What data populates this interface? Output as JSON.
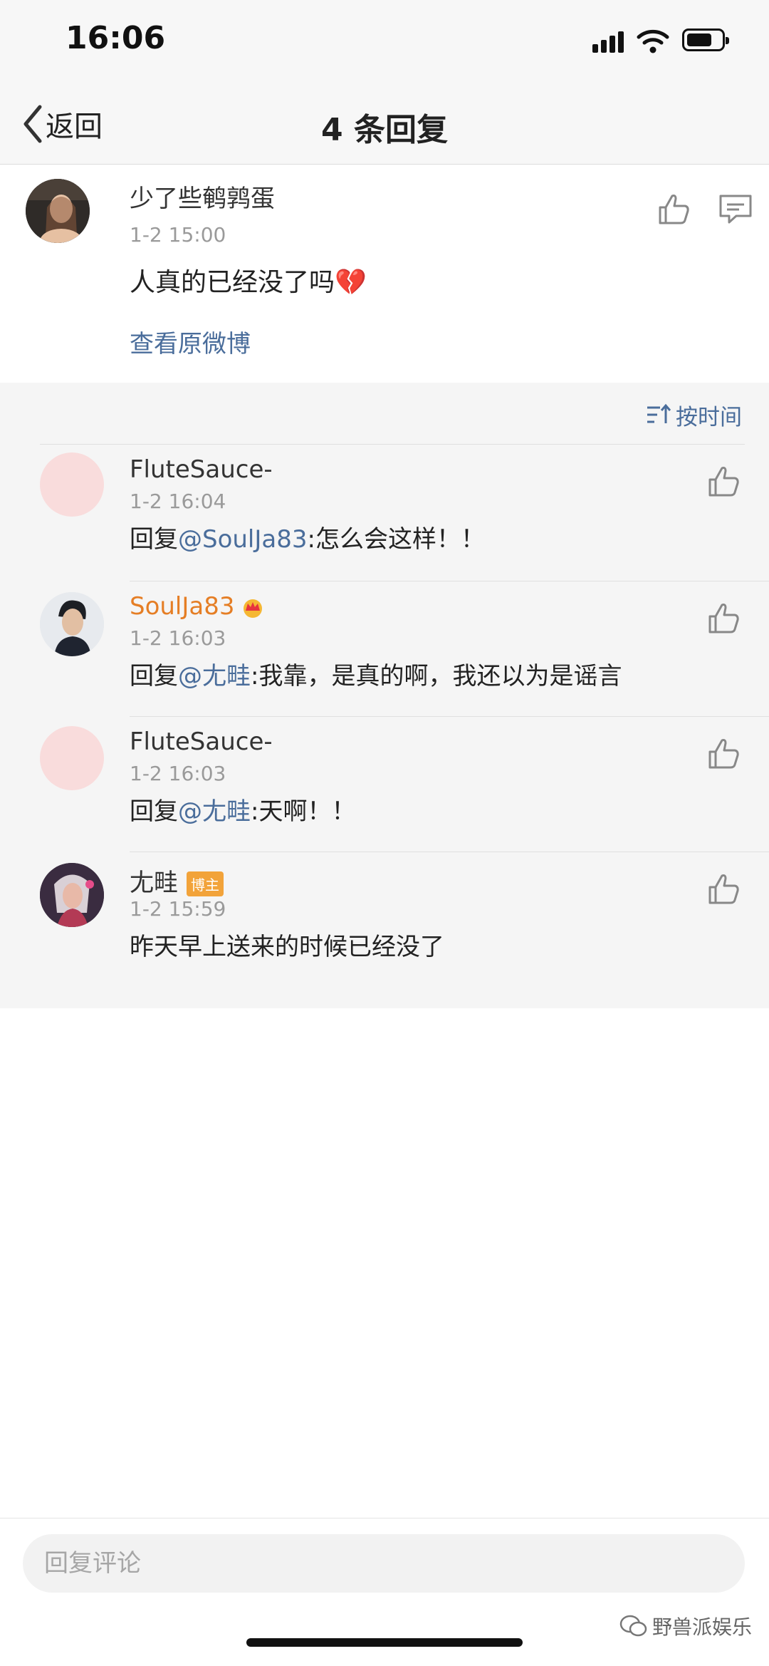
{
  "status": {
    "time": "16:06"
  },
  "nav": {
    "back_label": "返回",
    "title": "4 条回复"
  },
  "original": {
    "username": "少了些鹌鹑蛋",
    "time": "1-2 15:00",
    "text": "人真的已经没了吗",
    "emoji": "💔",
    "view_link": "查看原微博"
  },
  "sort": {
    "label": "按时间"
  },
  "replies": [
    {
      "username": "FluteSauce-",
      "time": "1-2 16:04",
      "prefix": "回复",
      "mention": "@SoulJa83",
      "text": ":怎么会这样！！"
    },
    {
      "username": "SoulJa83",
      "time": "1-2 16:03",
      "prefix": "回复",
      "mention": "@尢畦",
      "text": ":我靠，是真的啊，我还以为是谣言"
    },
    {
      "username": "FluteSauce-",
      "time": "1-2 16:03",
      "prefix": "回复",
      "mention": "@尢畦",
      "text": ":天啊！！"
    },
    {
      "username": "尢畦",
      "badge": "博主",
      "time": "1-2 15:59",
      "text": "昨天早上送来的时候已经没了"
    }
  ],
  "input": {
    "placeholder": "回复评论"
  },
  "watermark": "野兽派娱乐",
  "colors": {
    "link": "#4a6d9b",
    "vip": "#e57e25",
    "badge": "#f2a33a",
    "replies_bg": "#f5f5f5"
  }
}
